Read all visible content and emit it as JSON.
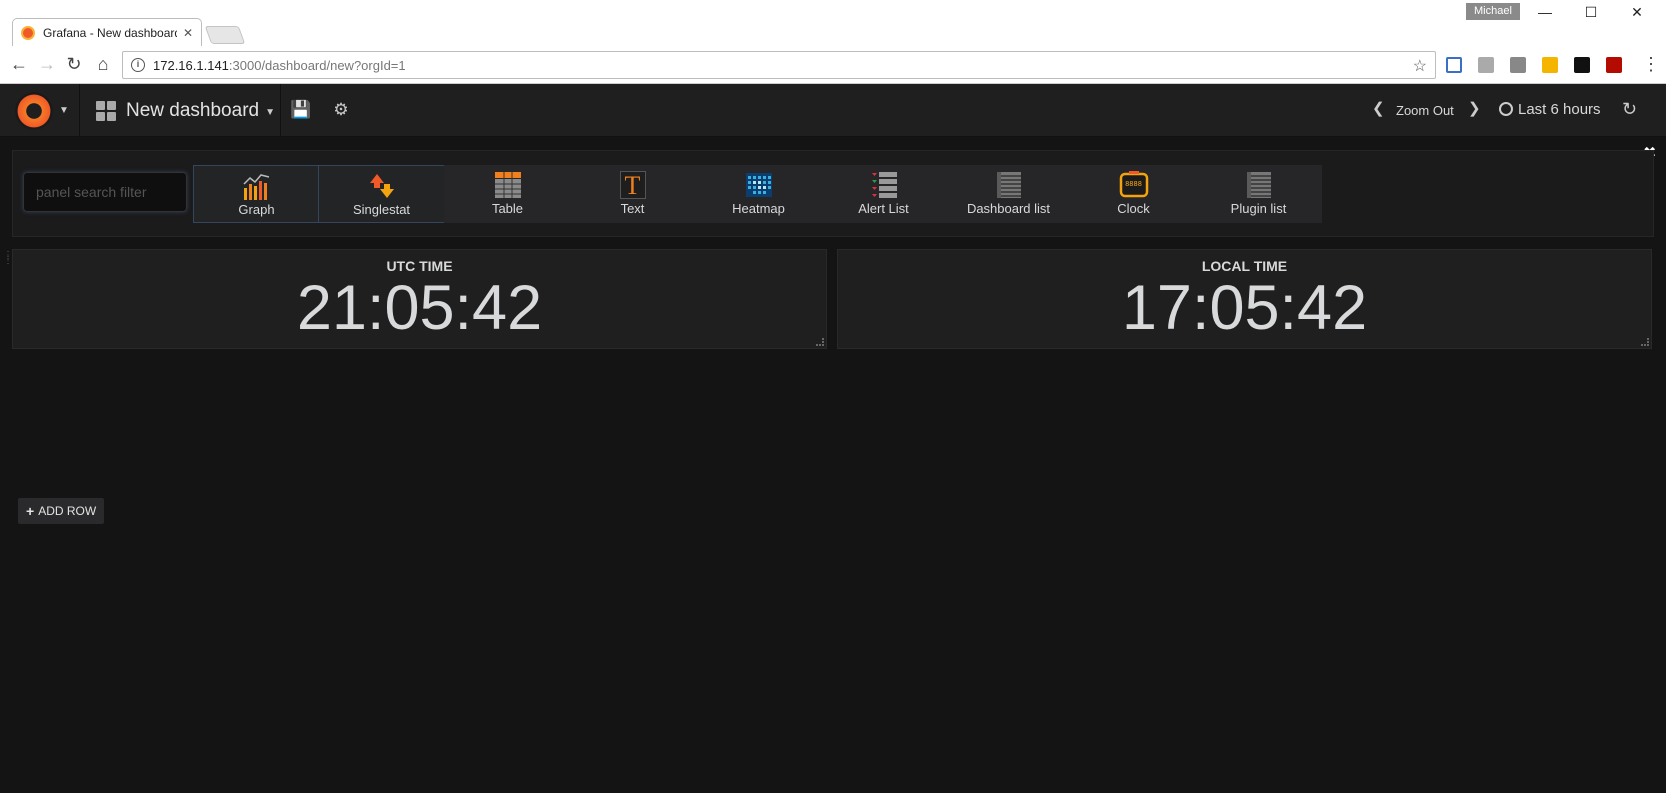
{
  "browser": {
    "tab_title": "Grafana - New dashboard",
    "tab_close": "✕",
    "profile_name": "Michael",
    "url_host": "172.16.1.141",
    "url_rest": ":3000/dashboard/new?orgId=1"
  },
  "grafana_nav": {
    "dashboard_title": "New dashboard",
    "zoom_out_label": "Zoom Out",
    "time_range": "Last 6 hours"
  },
  "add_panel": {
    "search_placeholder": "panel search filter",
    "close_glyph": "✖",
    "panel_types": [
      {
        "label": "Graph",
        "icon": "graph-icon"
      },
      {
        "label": "Singlestat",
        "icon": "singlestat-icon"
      },
      {
        "label": "Table",
        "icon": "table-icon"
      },
      {
        "label": "Text",
        "icon": "text-icon"
      },
      {
        "label": "Heatmap",
        "icon": "heatmap-icon"
      },
      {
        "label": "Alert List",
        "icon": "alert-list-icon"
      },
      {
        "label": "Dashboard list",
        "icon": "dashboard-list-icon"
      },
      {
        "label": "Clock",
        "icon": "clock-icon"
      },
      {
        "label": "Plugin list",
        "icon": "plugin-list-icon"
      }
    ],
    "text_icon_glyph": "T",
    "clock_icon_text": "8888"
  },
  "panels": [
    {
      "title": "UTC TIME",
      "value": "21:05:42"
    },
    {
      "title": "LOCAL TIME",
      "value": "17:05:42"
    }
  ],
  "add_row_label": "ADD ROW",
  "colors": {
    "background": "#141414",
    "panel_bg": "#1f1f20",
    "accent_orange": "#f05a28",
    "text": "#d8d9da"
  }
}
